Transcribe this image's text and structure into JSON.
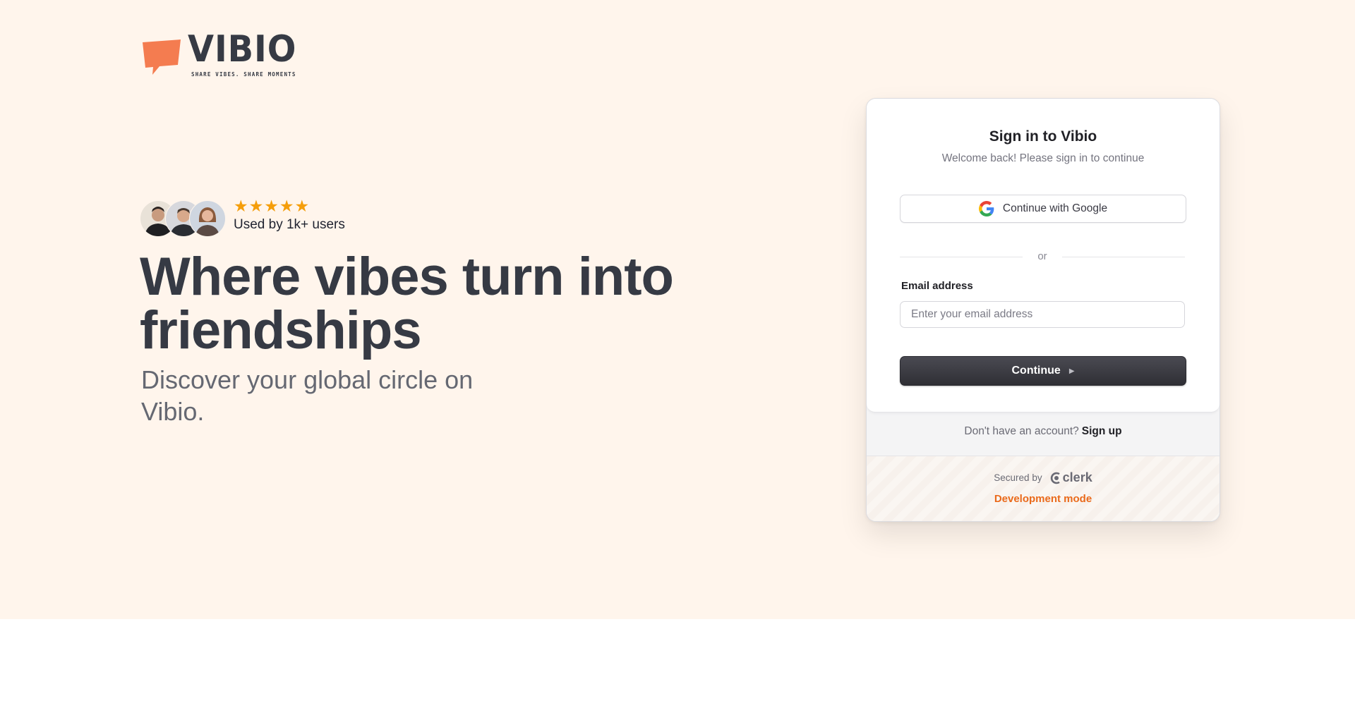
{
  "brand": {
    "name": "VIBIO",
    "tagline": "SHARE VIBES. SHARE MOMENTS",
    "accent": "#f47c50"
  },
  "hero": {
    "rating_stars": 5,
    "rating_text": "Used by 1k+ users",
    "headline": "Where vibes turn into friendships",
    "subheadline": "Discover your global circle on Vibio."
  },
  "signin": {
    "title": "Sign in to Vibio",
    "subtitle": "Welcome back! Please sign in to continue",
    "google_label": "Continue with Google",
    "divider": "or",
    "email_label": "Email address",
    "email_placeholder": "Enter your email address",
    "email_value": "",
    "continue_label": "Continue",
    "no_account_text": "Don't have an account?",
    "signup_label": "Sign up",
    "secured_by": "Secured by",
    "provider": "clerk",
    "dev_mode": "Development mode"
  },
  "icons": {
    "logo": "speech-bubble-icon",
    "star": "star-icon",
    "google": "google-icon",
    "continue": "caret-right-icon",
    "clerk": "clerk-logo-icon"
  },
  "colors": {
    "hero_bg": "#fff5ec",
    "text_dark": "#363a44",
    "star": "#f59e0b",
    "dev_mode": "#ea6a1b",
    "button_dark": "#2f2f35"
  }
}
